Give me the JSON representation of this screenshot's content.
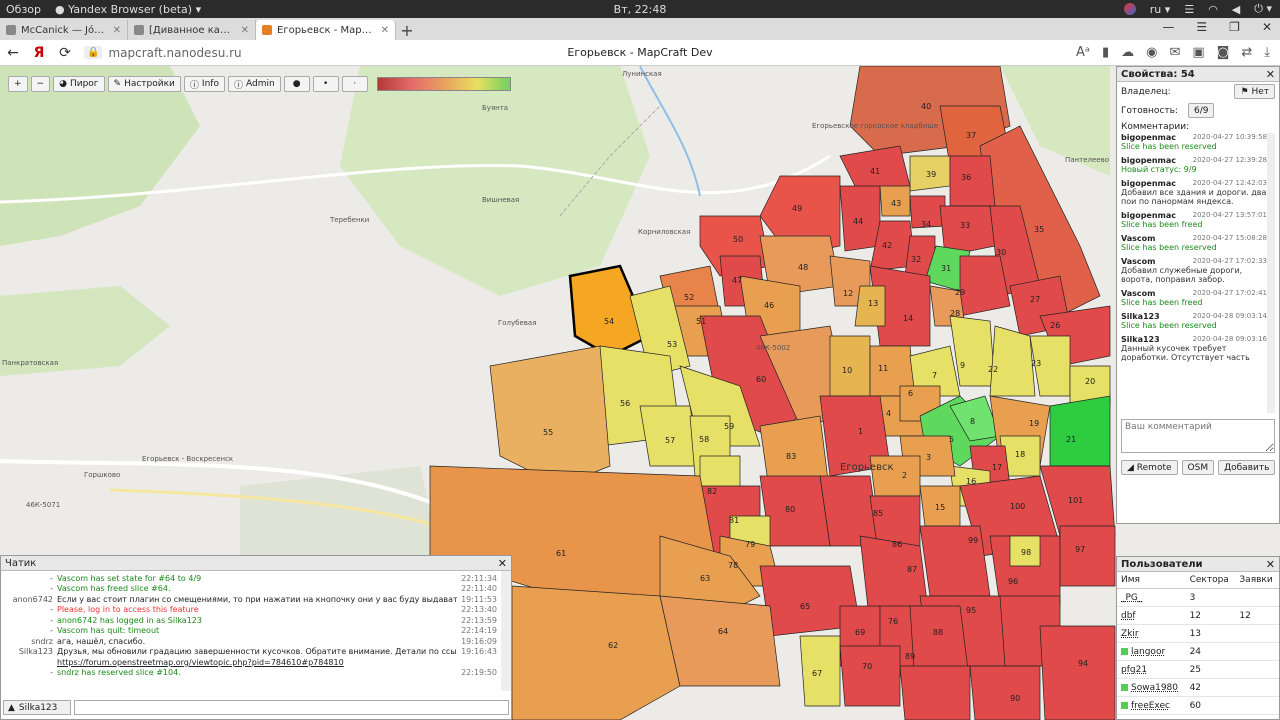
{
  "os": {
    "activities": "Обзор",
    "app": "Yandex Browser (beta)",
    "clock": "Вт, 22:48",
    "lang": "ru"
  },
  "tabs": [
    {
      "label": "McCanick — Jóhann"
    },
    {
      "label": "[Диванное картопати] Егорьевск"
    },
    {
      "label": "Егорьевск - MapCraft D",
      "active": true
    }
  ],
  "address": {
    "url": "mapcraft.nanodesu.ru",
    "title": "Егорьевск - MapCraft Dev"
  },
  "toolbar": {
    "zoom_in": "+",
    "zoom_out": "−",
    "pie": "Пирог",
    "settings": "Настройки",
    "info": "Info",
    "admin": "Admin"
  },
  "props": {
    "title": "Свойства: 54",
    "owner_label": "Владелец:",
    "owner_value": "Нет",
    "ready_label": "Готовность:",
    "ready_value": "6/9",
    "comments_label": "Комментарии:",
    "comments": [
      {
        "who": "bigopenmac",
        "when": "2020-04-27 10:39:58",
        "text": "Slice has been reserved",
        "green": true
      },
      {
        "who": "bigopenmac",
        "when": "2020-04-27 12:39:28",
        "text": "Новый статус: 9/9",
        "green": true
      },
      {
        "who": "bigopenmac",
        "when": "2020-04-27 12:42:03",
        "text": "Добавил все здания и дороги. два пои по панормам яндекса.",
        "green": false
      },
      {
        "who": "bigopenmac",
        "when": "2020-04-27 13:57:01",
        "text": "Slice has been freed",
        "green": true
      },
      {
        "who": "Vascom",
        "when": "2020-04-27 15:08:28",
        "text": "Slice has been reserved",
        "green": true
      },
      {
        "who": "Vascom",
        "when": "2020-04-27 17:02:33",
        "text": "Добавил служебные дороги, ворота, поправил забор.",
        "green": false
      },
      {
        "who": "Vascom",
        "when": "2020-04-27 17:02:41",
        "text": "Slice has been freed",
        "green": true
      },
      {
        "who": "Silka123",
        "when": "2020-04-28 09:03:14",
        "text": "Slice has been reserved",
        "green": true
      },
      {
        "who": "Silka123",
        "when": "2020-04-28 09:03:16",
        "text": "Данный кусочек требует доработки. Отсутствует часть",
        "green": false
      }
    ],
    "comment_placeholder": "Ваш комментарий",
    "remote": "Remote",
    "osm": "OSM",
    "add": "Добавить"
  },
  "users": {
    "title": "Пользователи",
    "col_name": "Имя",
    "col_sectors": "Сектора",
    "col_claims": "Заявки",
    "rows": [
      {
        "name": "_PG_",
        "sectors": "3",
        "online": false,
        "claims": ""
      },
      {
        "name": "dbf",
        "sectors": "12",
        "online": false,
        "claims": "12"
      },
      {
        "name": "Zkir",
        "sectors": "13",
        "online": false,
        "claims": ""
      },
      {
        "name": "langoor",
        "sectors": "24",
        "online": true,
        "claims": ""
      },
      {
        "name": "pfg21",
        "sectors": "25",
        "online": false,
        "claims": ""
      },
      {
        "name": "Sowa1980",
        "sectors": "42",
        "online": true,
        "claims": ""
      },
      {
        "name": "freeExec",
        "sectors": "60",
        "online": true,
        "claims": ""
      }
    ]
  },
  "chat": {
    "title": "Чатик",
    "lines": [
      {
        "nick": "-",
        "msg": "Vascom has set state for #64 to 4/9",
        "t": "22:11:34",
        "style": "green"
      },
      {
        "nick": "-",
        "msg": "Vascom has freed slice #64.",
        "t": "22:11:40",
        "style": "green"
      },
      {
        "nick": "anon6742",
        "msg": "Если у вас стоит плагин со смещениями, то при нажатии на кнопочку они у вас буду выдаваться.",
        "t": "19:11:53",
        "style": ""
      },
      {
        "nick": "-",
        "msg": "Please, log in to access this feature",
        "t": "22:13:40",
        "style": "red"
      },
      {
        "nick": "-",
        "msg": "anon6742 has logged in as Silka123",
        "t": "22:13:59",
        "style": "green"
      },
      {
        "nick": "-",
        "msg": "Vascom has quit: timeout",
        "t": "22:14:19",
        "style": "green"
      },
      {
        "nick": "sndrz",
        "msg": "ага, нашёл, спасибо.",
        "t": "19:16:09",
        "style": ""
      },
      {
        "nick": "Silka123",
        "msg": "Друзья, мы обновили градацию завершенности кусочков. Обратите внимание. Детали по ссылке:",
        "t": "19:16:43",
        "style": ""
      },
      {
        "nick": "",
        "msg": "https://forum.openstreetmap.org/viewtopic.php?pid=784610#p784810",
        "t": "",
        "style": "link"
      },
      {
        "nick": "-",
        "msg": "sndrz has reserved slice #104.",
        "t": "22:19:50",
        "style": "green"
      }
    ],
    "me": "Silka123"
  },
  "map_labels": {
    "lukhinskaya": "Лунинская",
    "buyanta": "Буянта",
    "terebenki": "Теребенки",
    "vishnevaya": "Вишневая",
    "kornilovskaya": "Корниловская",
    "golubevaya": "Голубевая",
    "pankratovskaya": "Панкратовская",
    "gorshkovo": "Горшково",
    "egoryevsk_voskresensk": "Егорьевск - Воскресенск",
    "egoryevsk": "Егорьевск",
    "cemetery": "Егорьевское городское кладбище",
    "panteleevo": "Пантелеево",
    "road_46k": "46К-5071",
    "road_46k2": "46К-5002"
  },
  "slices": [
    {
      "id": "40",
      "color": "#d9654d"
    },
    {
      "id": "37",
      "color": "#d9654d"
    },
    {
      "id": "54",
      "color": "#f5a623"
    },
    {
      "id": "31",
      "color": "#5ed95e"
    },
    {
      "id": "5",
      "color": "#5ed95e"
    },
    {
      "id": "21",
      "color": "#2ecc40"
    }
  ]
}
